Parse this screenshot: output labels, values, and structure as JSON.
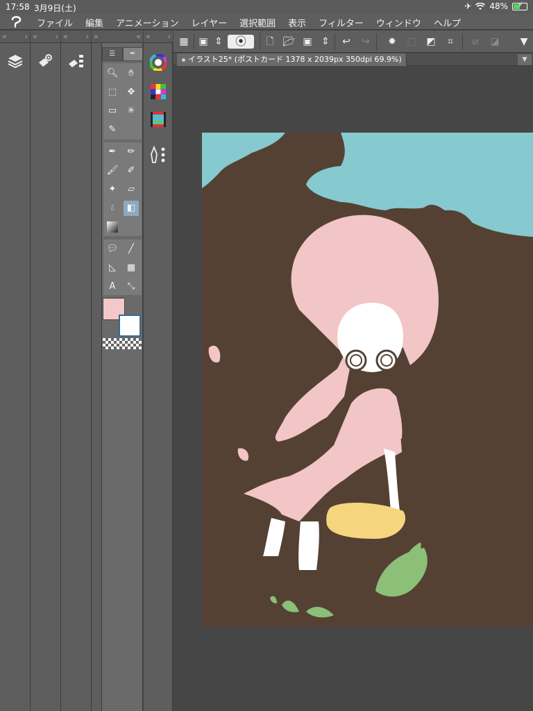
{
  "status_bar": {
    "time": "17:58",
    "date": "3月9日(土)",
    "battery": "48%",
    "battery_level": 0.48
  },
  "menu": {
    "items": [
      "ファイル",
      "編集",
      "アニメーション",
      "レイヤー",
      "選択範囲",
      "表示",
      "フィルター",
      "ウィンドウ",
      "ヘルプ"
    ]
  },
  "document": {
    "tab_label": "イラスト25* (ポストカード 1378 x 2039px 350dpi 69.9%)"
  },
  "colors": {
    "main_color": "#f2c8c9",
    "sub_color": "#ffffff",
    "sky": "#86c9cf",
    "ground": "#544134",
    "hair_dress": "#f2c5c6",
    "stump_top": "#f6d57f",
    "leaves": "#8cbf78"
  },
  "icons": {
    "layer_panel": "layers-icon",
    "tool_property": "tool-property-icon",
    "sub_tool_detail": "sub-tool-detail-icon",
    "color_wheel": "color-wheel-icon",
    "color_set": "color-set-icon",
    "animation": "timeline-icon",
    "layer_property": "layer-property-icon"
  }
}
